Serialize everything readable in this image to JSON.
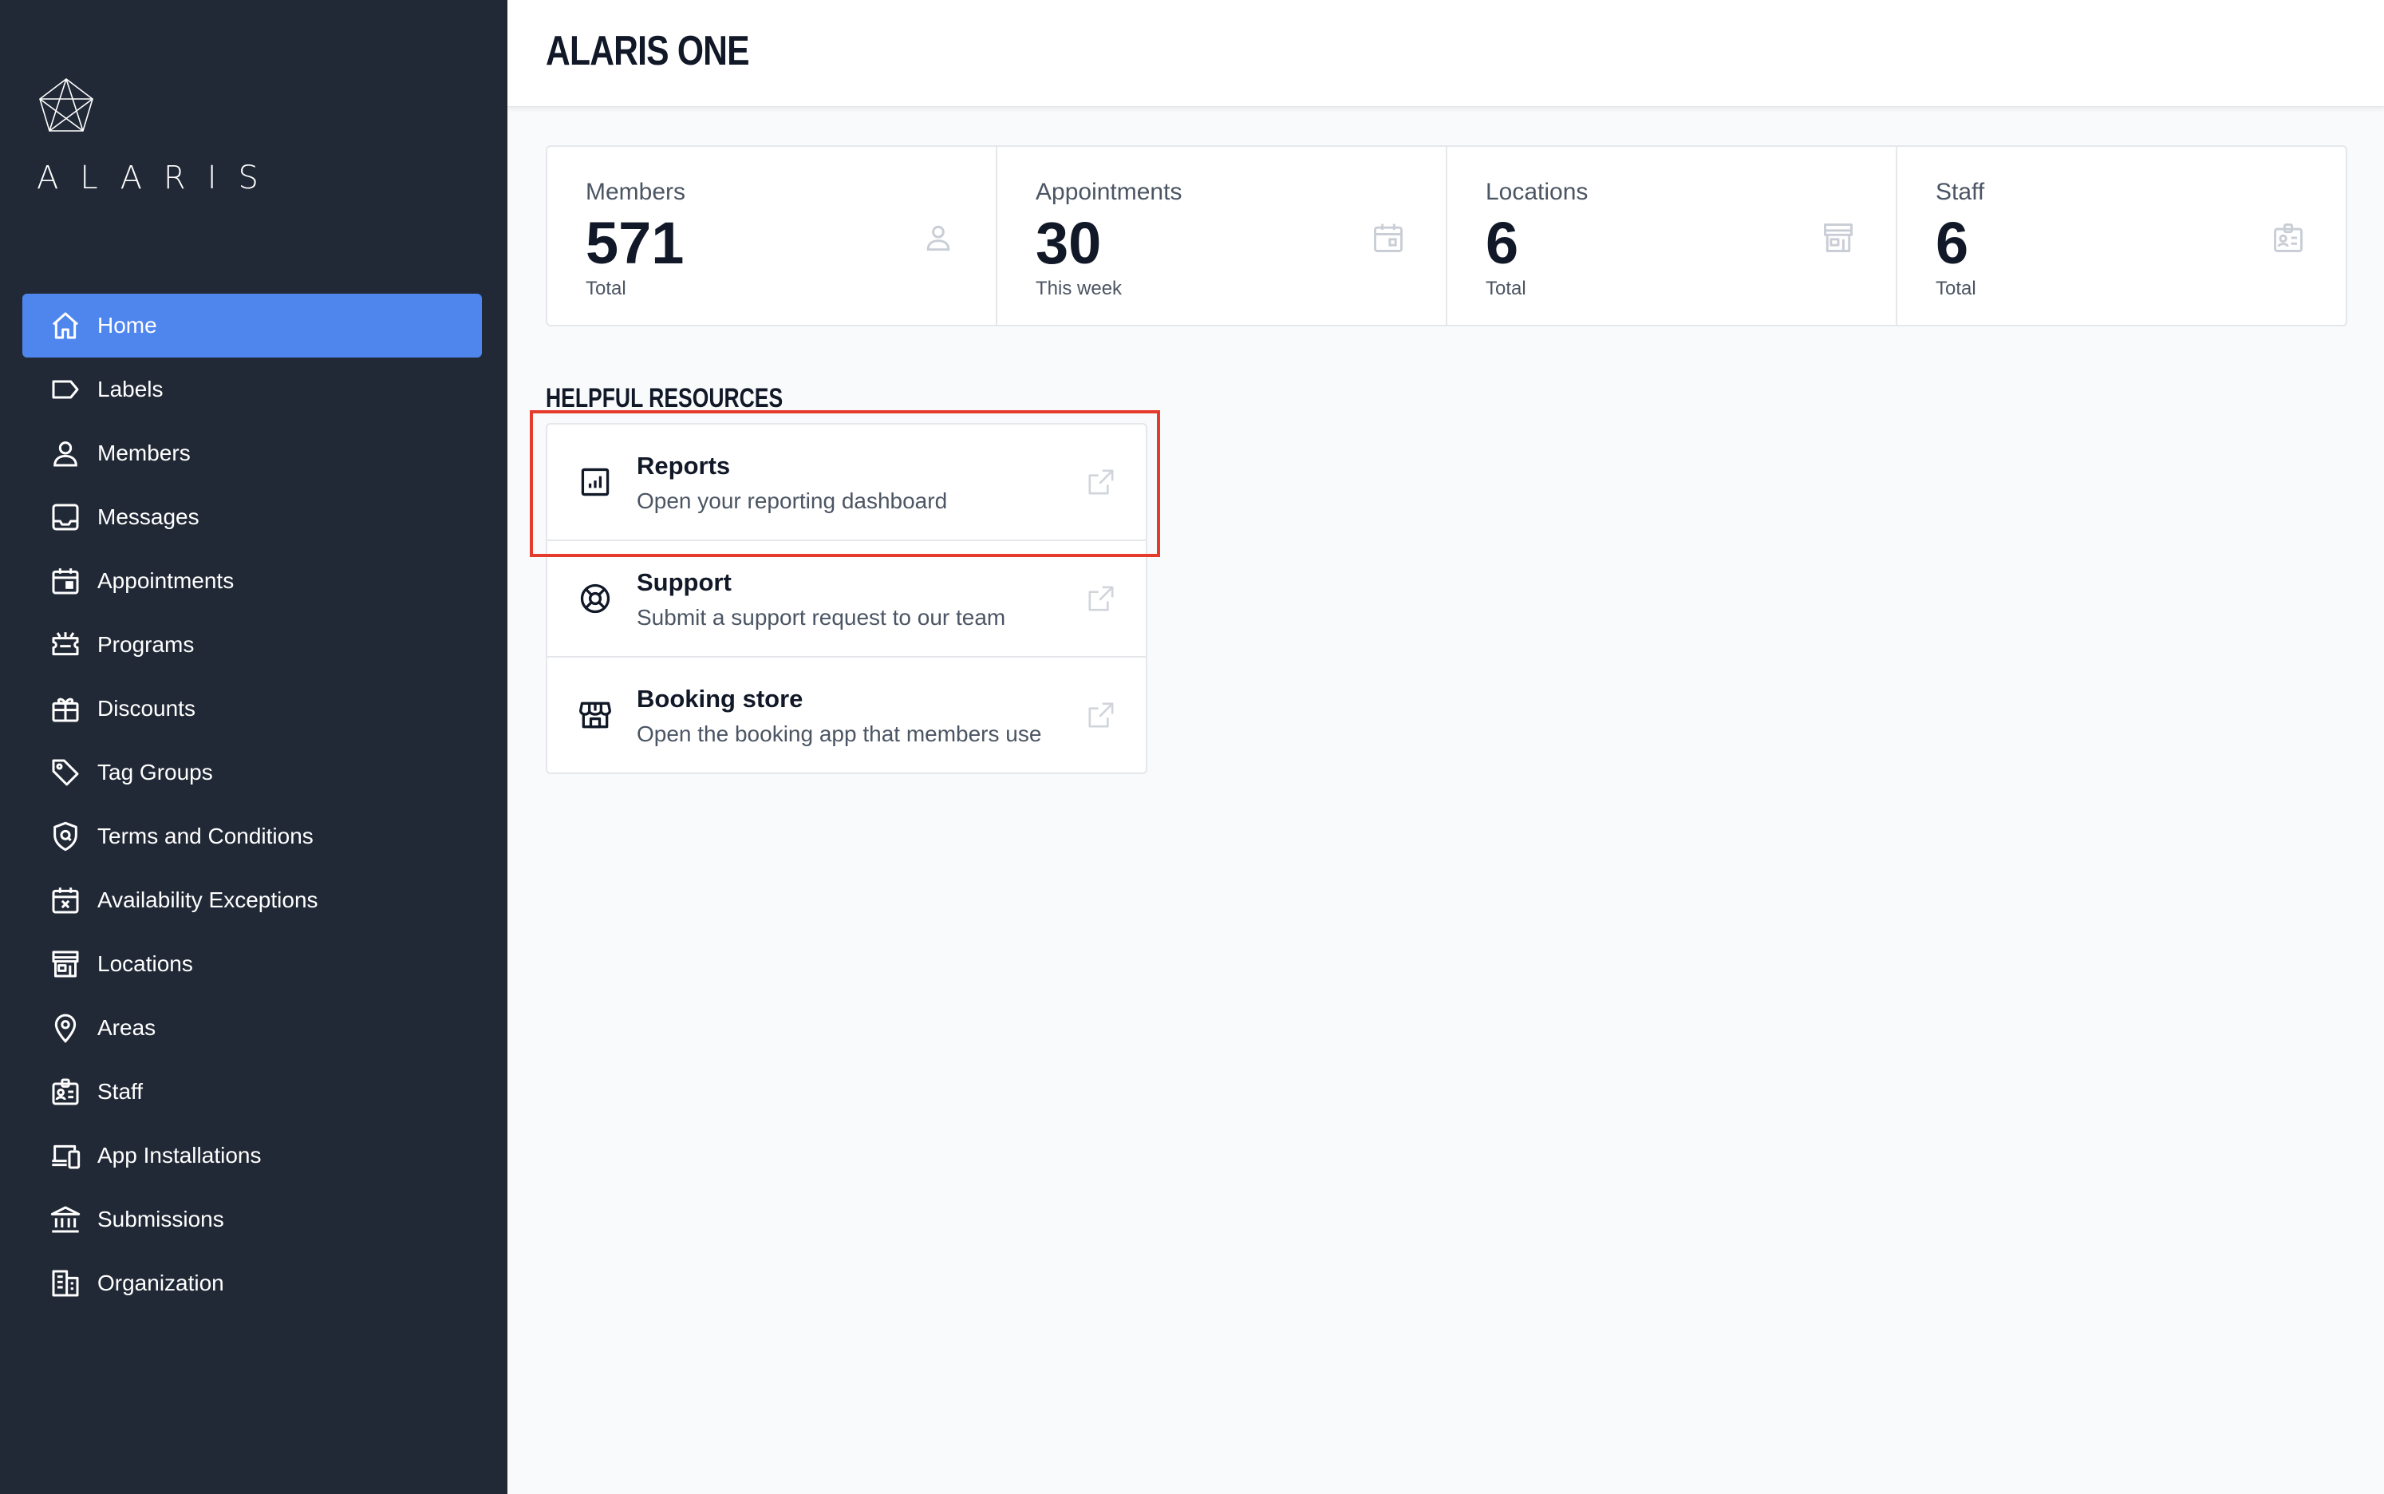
{
  "brand": {
    "name": "ALARIS"
  },
  "header": {
    "title": "ALARIS ONE"
  },
  "colors": {
    "sidebar": "#222936",
    "accent": "#4f86ee",
    "highlight": "#e53b2c"
  },
  "nav": {
    "items": [
      {
        "label": "Home",
        "icon": "home-icon",
        "active": true
      },
      {
        "label": "Labels",
        "icon": "label-icon"
      },
      {
        "label": "Members",
        "icon": "user-icon"
      },
      {
        "label": "Messages",
        "icon": "inbox-icon"
      },
      {
        "label": "Appointments",
        "icon": "calendar-icon"
      },
      {
        "label": "Programs",
        "icon": "ticket-icon"
      },
      {
        "label": "Discounts",
        "icon": "gift-icon"
      },
      {
        "label": "Tag Groups",
        "icon": "tag-icon"
      },
      {
        "label": "Terms and Conditions",
        "icon": "shield-icon"
      },
      {
        "label": "Availability Exceptions",
        "icon": "calendar-x-icon"
      },
      {
        "label": "Locations",
        "icon": "store-icon"
      },
      {
        "label": "Areas",
        "icon": "map-pin-icon"
      },
      {
        "label": "Staff",
        "icon": "id-badge-icon"
      },
      {
        "label": "App Installations",
        "icon": "devices-icon"
      },
      {
        "label": "Submissions",
        "icon": "bank-icon"
      },
      {
        "label": "Organization",
        "icon": "building-icon"
      }
    ]
  },
  "stats": [
    {
      "label": "Members",
      "value": "571",
      "sub": "Total",
      "icon": "user-icon"
    },
    {
      "label": "Appointments",
      "value": "30",
      "sub": "This week",
      "icon": "calendar-icon"
    },
    {
      "label": "Locations",
      "value": "6",
      "sub": "Total",
      "icon": "store-icon"
    },
    {
      "label": "Staff",
      "value": "6",
      "sub": "Total",
      "icon": "id-badge-icon"
    }
  ],
  "resources": {
    "heading": "HELPFUL RESOURCES",
    "items": [
      {
        "title": "Reports",
        "desc": "Open your reporting dashboard",
        "icon": "chart-icon"
      },
      {
        "title": "Support",
        "desc": "Submit a support request to our team",
        "icon": "lifebuoy-icon"
      },
      {
        "title": "Booking store",
        "desc": "Open the booking app that members use",
        "icon": "store-icon"
      }
    ]
  }
}
